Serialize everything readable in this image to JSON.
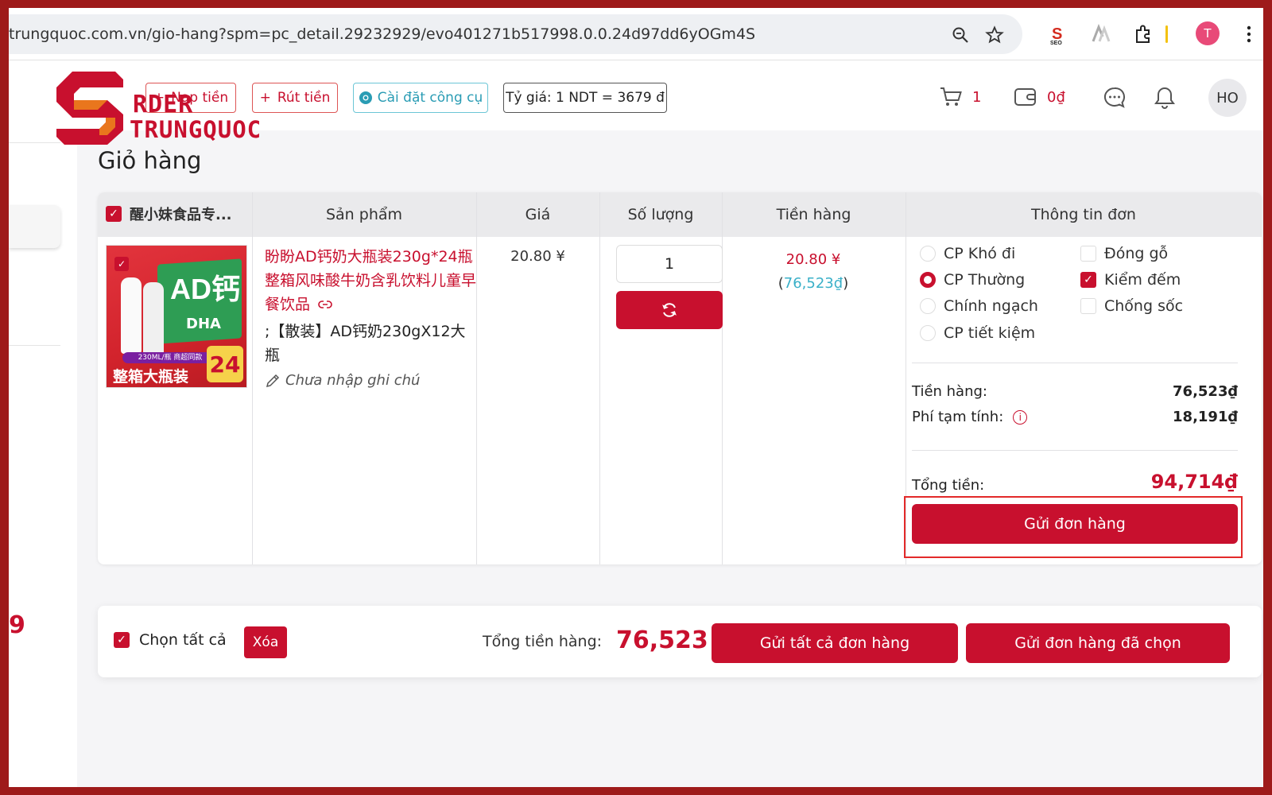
{
  "browser": {
    "url": "trungquoc.com.vn/gio-hang?spm=pc_detail.29232929/evo401271b517998.0.0.24d97dd6yOGm4S",
    "profile_initial": "T",
    "icons": [
      "zoom-icon",
      "bookmark-star-icon",
      "seo-extension-icon",
      "extension-icon",
      "puzzle-extensions-icon",
      "menu-dots-icon"
    ]
  },
  "logo": {
    "line1": "RDER",
    "line2": "TRUNGQUOC"
  },
  "header": {
    "deposit_label": "Nạp tiền",
    "withdraw_label": "Rút tiền",
    "install_tool_label": "Cài đặt công cụ",
    "exchange_rate": "Tỷ giá: 1 NDT = 3679 đ",
    "cart_count": "1",
    "wallet_balance": "0₫",
    "avatar_initials": "HO"
  },
  "sidebar": {
    "red_fragment": "9"
  },
  "page": {
    "title": "Giỏ hàng"
  },
  "cart": {
    "shop_name": "醒小妹食品专...",
    "columns": {
      "product": "Sản phẩm",
      "price": "Giá",
      "quantity": "Số lượng",
      "amount": "Tiền hàng",
      "order_info": "Thông tin đơn"
    },
    "item": {
      "title": "盼盼AD钙奶大瓶装230g*24瓶整箱风味酸牛奶含乳饮料儿童早餐饮品",
      "variant": ";【散装】AD钙奶230gX12大瓶",
      "note_placeholder": "Chưa nhập ghi chú",
      "price": "20.80 ¥",
      "quantity": "1",
      "amount_cny": "20.80 ¥",
      "amount_vnd": "76,523₫",
      "image_text": {
        "brand": "AD钙",
        "dha": "DHA",
        "volume": "230ML/瓶 商超同款",
        "pack": "整箱大瓶装",
        "count": "24"
      }
    },
    "shipping_options": [
      {
        "label": "CP Khó đi",
        "selected": false
      },
      {
        "label": "CP Thường",
        "selected": true
      },
      {
        "label": "Chính ngạch",
        "selected": false
      },
      {
        "label": "CP tiết kiệm",
        "selected": false
      }
    ],
    "service_options": [
      {
        "label": "Đóng gỗ",
        "checked": false
      },
      {
        "label": "Kiểm đếm",
        "checked": true
      },
      {
        "label": "Chống sốc",
        "checked": false
      }
    ],
    "summary": {
      "goods_label": "Tiền hàng:",
      "goods_value": "76,523₫",
      "fee_label": "Phí tạm tính:",
      "fee_value": "18,191₫",
      "total_label": "Tổng tiền:",
      "total_value": "94,714₫"
    },
    "send_order_label": "Gửi đơn hàng"
  },
  "footer": {
    "select_all_label": "Chọn tất cả",
    "delete_label": "Xóa",
    "total_label": "Tổng tiền hàng:",
    "total_value": "76,523",
    "send_all_label": "Gửi tất cả đơn hàng",
    "send_selected_label": "Gửi đơn hàng đã chọn"
  },
  "colors": {
    "brand_red": "#c8102e",
    "frame_red": "#9e1a1a",
    "cyan": "#3ab0c8"
  }
}
